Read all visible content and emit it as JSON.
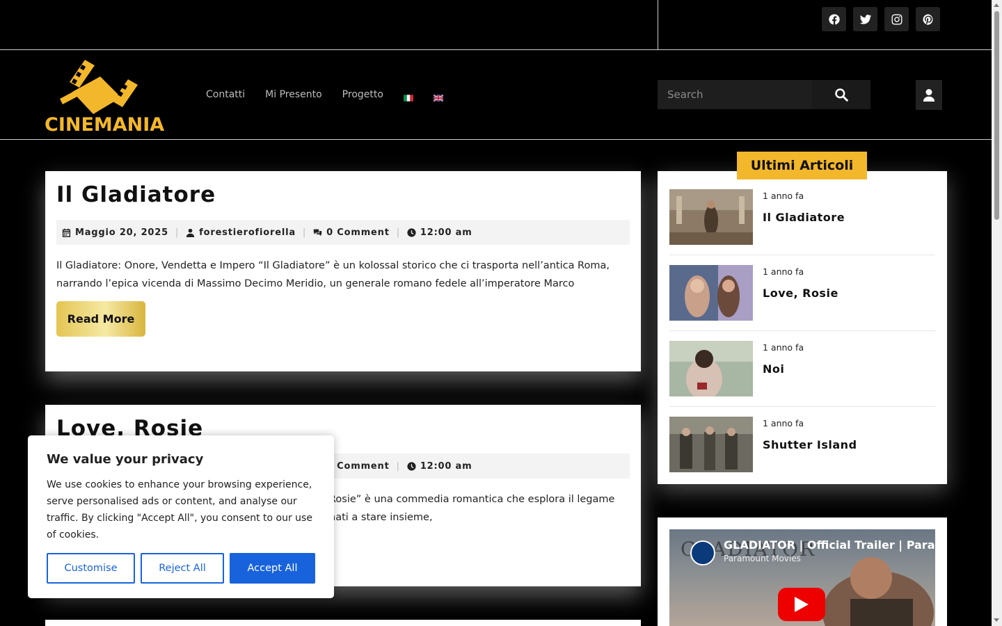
{
  "brand": {
    "logo_text": "CINEMANIA",
    "accent": "#f3b72b"
  },
  "social": [
    "facebook-icon",
    "twitter-icon",
    "instagram-icon",
    "pinterest-icon"
  ],
  "nav": {
    "items": [
      "Contatti",
      "Mi Presento",
      "Progetto"
    ],
    "flags": [
      "italian-flag-icon",
      "uk-flag-icon"
    ]
  },
  "search": {
    "placeholder": "Search"
  },
  "posts": [
    {
      "title": "Il Gladiatore",
      "date": "Maggio 20, 2025",
      "author": "forestierofiorella",
      "comments": "0 Comment",
      "time": "12:00 am",
      "excerpt": "Il Gladiatore: Onore, Vendetta e Impero “Il Gladiatore” è un kolossal storico che ci trasporta nell’antica Roma, narrando l’epica vicenda di Massimo Decimo Meridio, un generale romano fedele all’imperatore Marco",
      "read_more": "Read More"
    },
    {
      "title": "Love, Rosie",
      "comments": "0 Comment",
      "time": "12:00 am",
      "excerpt_line1": "Rosie” è una commedia romantica che esplora il legame",
      "excerpt_line2": "nati a stare insieme,"
    }
  ],
  "sidebar": {
    "title": "Ultimi Articoli",
    "items": [
      {
        "ago": "1 anno fa",
        "title": "Il Gladiatore"
      },
      {
        "ago": "1 anno fa",
        "title": "Love, Rosie"
      },
      {
        "ago": "1 anno fa",
        "title": "Noi"
      },
      {
        "ago": "1 anno fa",
        "title": "Shutter Island"
      }
    ]
  },
  "video": {
    "title": "GLADIATOR | Official Trailer | Paramo",
    "channel": "Paramount Movies",
    "poster_text": "GLADIATOR"
  },
  "cookie": {
    "title": "We value your privacy",
    "text": "We use cookies to enhance your browsing experience, serve personalised ads or content, and analyse our traffic. By clicking \"Accept All\", you consent to our use of cookies.",
    "customise": "Customise",
    "reject": "Reject All",
    "accept": "Accept All",
    "primary_color": "#1863dc"
  }
}
